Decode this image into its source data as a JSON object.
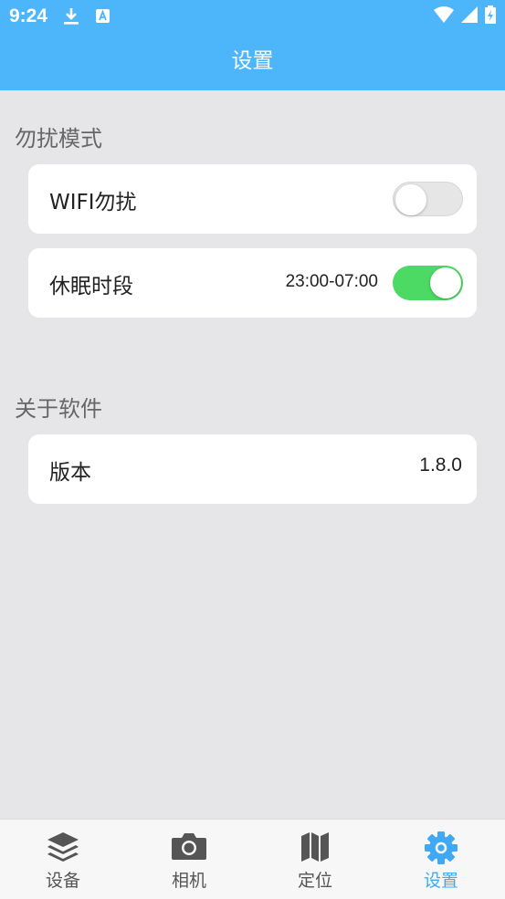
{
  "status_bar": {
    "time": "9:24"
  },
  "app_bar": {
    "title": "设置"
  },
  "sections": {
    "dnd": {
      "title": "勿扰模式",
      "wifi": {
        "label": "WIFI勿扰",
        "enabled": false
      },
      "sleep": {
        "label": "休眠时段",
        "range": "23:00-07:00",
        "enabled": true
      }
    },
    "about": {
      "title": "关于软件",
      "version": {
        "label": "版本",
        "value": "1.8.0"
      }
    }
  },
  "tabs": [
    {
      "label": "设备",
      "icon": "layers-icon"
    },
    {
      "label": "相机",
      "icon": "camera-icon"
    },
    {
      "label": "定位",
      "icon": "map-icon"
    },
    {
      "label": "设置",
      "icon": "gear-icon",
      "active": true
    }
  ],
  "colors": {
    "primary": "#4db6fb",
    "switch_on": "#4cd964",
    "active_tab": "#3fa9f5"
  }
}
